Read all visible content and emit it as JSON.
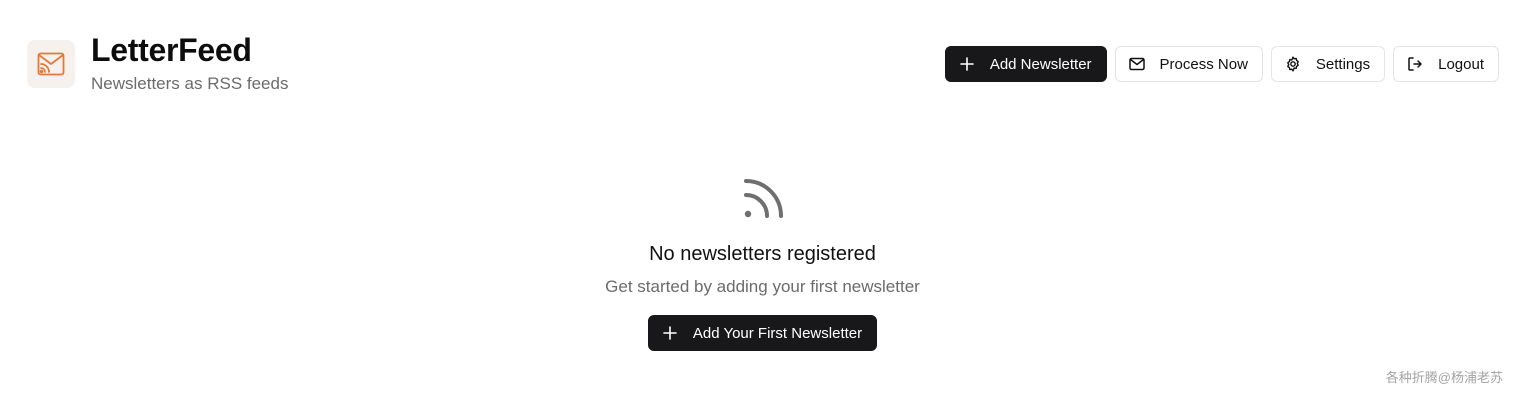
{
  "header": {
    "title": "LetterFeed",
    "subtitle": "Newsletters as RSS feeds",
    "logo_icon": "mail-rss-icon",
    "logo_color": "#e07a3c"
  },
  "toolbar": {
    "add_newsletter_label": "Add Newsletter",
    "process_now_label": "Process Now",
    "settings_label": "Settings",
    "logout_label": "Logout"
  },
  "empty_state": {
    "icon": "rss-icon",
    "title": "No newsletters registered",
    "description": "Get started by adding your first newsletter",
    "button_label": "Add Your First Newsletter"
  },
  "watermark": "各种折腾@杨浦老苏",
  "colors": {
    "primary": "#18181b",
    "muted_text": "#6b6b6b",
    "border": "#e4e4e7",
    "logo_bg": "#f6f1ec"
  }
}
